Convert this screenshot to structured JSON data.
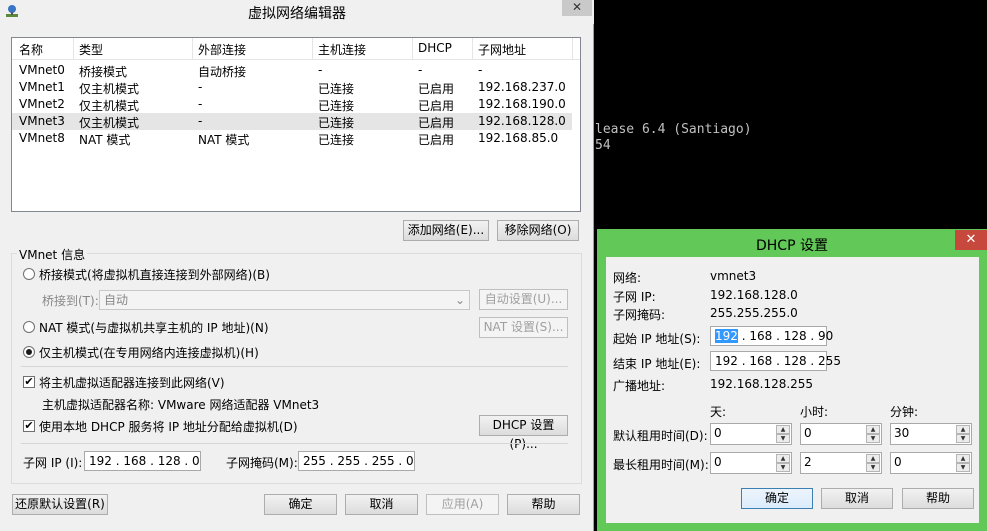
{
  "main_window": {
    "title": "虚拟网络编辑器",
    "close_glyph": "✕",
    "columns": [
      "名称",
      "类型",
      "外部连接",
      "主机连接",
      "DHCP",
      "子网地址"
    ],
    "rows": [
      {
        "name": "VMnet0",
        "type": "桥接模式",
        "external": "自动桥接",
        "host": "-",
        "dhcp": "-",
        "subnet": "-"
      },
      {
        "name": "VMnet1",
        "type": "仅主机模式",
        "external": "-",
        "host": "已连接",
        "dhcp": "已启用",
        "subnet": "192.168.237.0"
      },
      {
        "name": "VMnet2",
        "type": "仅主机模式",
        "external": "-",
        "host": "已连接",
        "dhcp": "已启用",
        "subnet": "192.168.190.0"
      },
      {
        "name": "VMnet3",
        "type": "仅主机模式",
        "external": "-",
        "host": "已连接",
        "dhcp": "已启用",
        "subnet": "192.168.128.0"
      },
      {
        "name": "VMnet8",
        "type": "NAT 模式",
        "external": "NAT 模式",
        "host": "已连接",
        "dhcp": "已启用",
        "subnet": "192.168.85.0"
      }
    ],
    "add_network": "添加网络(E)...",
    "remove_network": "移除网络(O)",
    "group_label": "VMnet 信息",
    "bridge_mode": "桥接模式(将虚拟机直接连接到外部网络)(B)",
    "bridge_to_label": "桥接到(T):",
    "bridge_to_value": "自动",
    "auto_settings": "自动设置(U)...",
    "nat_mode": "NAT 模式(与虚拟机共享主机的 IP 地址)(N)",
    "nat_settings": "NAT 设置(S)...",
    "host_only_mode": "仅主机模式(在专用网络内连接虚拟机)(H)",
    "connect_adapter": "将主机虚拟适配器连接到此网络(V)",
    "adapter_name": "主机虚拟适配器名称: VMware 网络适配器 VMnet3",
    "use_dhcp": "使用本地 DHCP 服务将 IP 地址分配给虚拟机(D)",
    "dhcp_settings": "DHCP 设置(P)...",
    "subnet_ip_label": "子网 IP (I):",
    "subnet_ip_value": "192 . 168 . 128 .  0",
    "subnet_mask_label": "子网掩码(M):",
    "subnet_mask_value": "255 . 255 . 255 .  0",
    "restore_defaults": "还原默认设置(R)",
    "ok": "确定",
    "cancel": "取消",
    "apply": "应用(A)",
    "help": "帮助"
  },
  "terminal": {
    "line1": "lease 6.4 (Santiago)",
    "line2": "54"
  },
  "dhcp_dialog": {
    "title": "DHCP 设置",
    "close_glyph": "✕",
    "network_label": "网络:",
    "network_value": "vmnet3",
    "subnet_ip_label": "子网 IP:",
    "subnet_ip_value": "192.168.128.0",
    "subnet_mask_label": "子网掩码:",
    "subnet_mask_value": "255.255.255.0",
    "start_ip_label": "起始 IP 地址(S):",
    "start_ip_selected": "192",
    "start_ip_rest": " . 168 . 128 . 90",
    "end_ip_label": "结束 IP 地址(E):",
    "end_ip_value": "192 . 168 . 128 . 255",
    "broadcast_label": "广播地址:",
    "broadcast_value": "192.168.128.255",
    "days_label": "天:",
    "hours_label": "小时:",
    "minutes_label": "分钟:",
    "default_lease_label": "默认租用时间(D):",
    "default_days": "0",
    "default_hours": "0",
    "default_minutes": "30",
    "max_lease_label": "最长租用时间(M):",
    "max_days": "0",
    "max_hours": "2",
    "max_minutes": "0",
    "ok": "确定",
    "cancel": "取消",
    "help": "帮助"
  }
}
